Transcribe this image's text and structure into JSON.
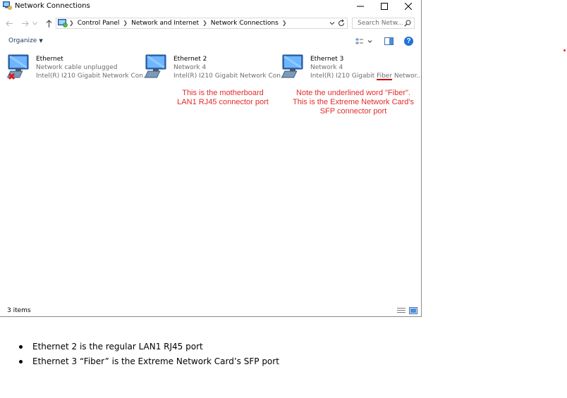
{
  "window": {
    "title": "Network Connections",
    "search_placeholder": "Search Netw...",
    "breadcrumb": [
      "Control Panel",
      "Network and Internet",
      "Network Connections"
    ],
    "organize_label": "Organize",
    "status_items": "3 items"
  },
  "connections": [
    {
      "name": "Ethernet",
      "status": "Network cable unplugged",
      "device": "Intel(R) I210 Gigabit Network Con...",
      "state": "disconnected"
    },
    {
      "name": "Ethernet 2",
      "status": "Network 4",
      "device": "Intel(R) I210 Gigabit Network Con...",
      "state": "connected"
    },
    {
      "name": "Ethernet 3",
      "status": "Network 4",
      "device_prefix": "Intel(R) I210 Gigabit ",
      "device_fiber": "Fiber",
      "device_suffix": " Networ...",
      "state": "connected"
    }
  ],
  "annotations": {
    "note_2": [
      "This is the motherboard",
      "LAN1 RJ45 connector port"
    ],
    "note_3": [
      "Note the underlined word \"Fiber\".",
      "This is the Extreme Network Card's",
      "SFP connector port"
    ]
  },
  "bullets": [
    "Ethernet 2 is the regular LAN1 RJ45 port",
    "Ethernet 3 “Fiber” is the Extreme Network Card’s SFP port"
  ],
  "colors": {
    "annotation_red": "#e32b2b",
    "link_blue": "#1e395b",
    "help_blue": "#1f73d6"
  }
}
